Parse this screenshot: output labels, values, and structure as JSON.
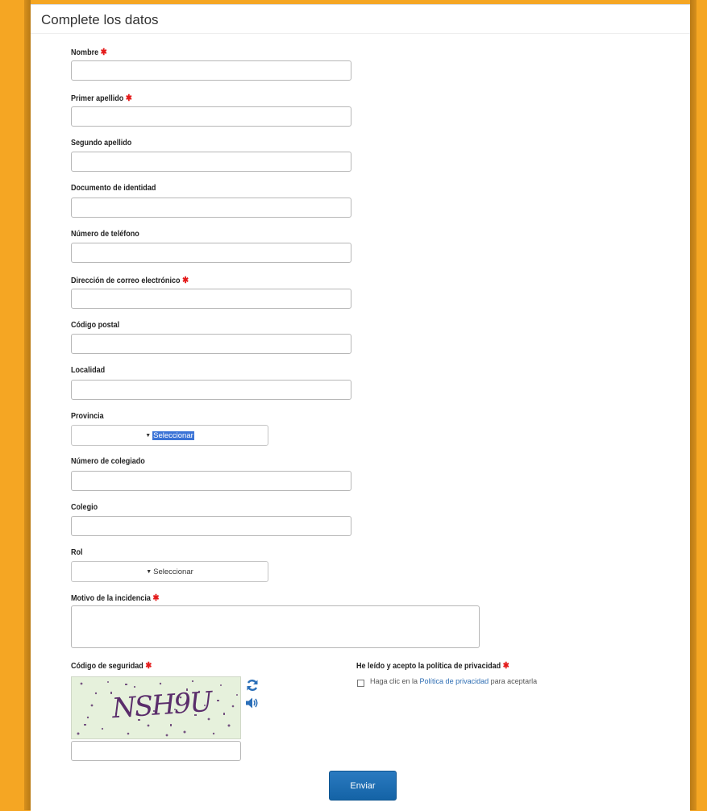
{
  "page": {
    "title": "Complete los datos"
  },
  "fields": {
    "nombre": {
      "label": "Nombre",
      "required": true,
      "value": ""
    },
    "primer_apellido": {
      "label": "Primer apellido",
      "required": true,
      "value": ""
    },
    "segundo_apellido": {
      "label": "Segundo apellido",
      "required": false,
      "value": ""
    },
    "documento": {
      "label": "Documento de identidad",
      "required": false,
      "value": ""
    },
    "telefono": {
      "label": "Número de teléfono",
      "required": false,
      "value": ""
    },
    "correo": {
      "label": "Dirección de correo electrónico",
      "required": true,
      "value": ""
    },
    "codigo_postal": {
      "label": "Código postal",
      "required": false,
      "value": ""
    },
    "localidad": {
      "label": "Localidad",
      "required": false,
      "value": ""
    },
    "provincia": {
      "label": "Provincia",
      "required": false,
      "selected": "Seleccionar"
    },
    "colegiado": {
      "label": "Número de colegiado",
      "required": false,
      "value": ""
    },
    "colegio": {
      "label": "Colegio",
      "required": false,
      "value": ""
    },
    "rol": {
      "label": "Rol",
      "required": false,
      "selected": "Seleccionar"
    },
    "motivo": {
      "label": "Motivo de la incidencia",
      "required": true,
      "value": ""
    },
    "codigo_seguridad": {
      "label": "Código de seguridad",
      "required": true,
      "captcha_text": "NSH9U",
      "value": ""
    }
  },
  "privacy": {
    "label": "He leído y acepto la política de privacidad",
    "required": true,
    "checked": false,
    "text_before": "Haga clic en la ",
    "link_text": "Política de privacidad",
    "text_after": " para aceptarla"
  },
  "required_marker": "✱",
  "submit": {
    "label": "Enviar"
  },
  "icons": {
    "refresh": "refresh-icon",
    "audio": "audio-icon",
    "caret": "caret-down-icon"
  },
  "colors": {
    "background": "#f5a623",
    "required": "#e41b1b",
    "button": "#1a6db5",
    "link": "#2d6db3",
    "selection_highlight": "#3b73d6"
  }
}
